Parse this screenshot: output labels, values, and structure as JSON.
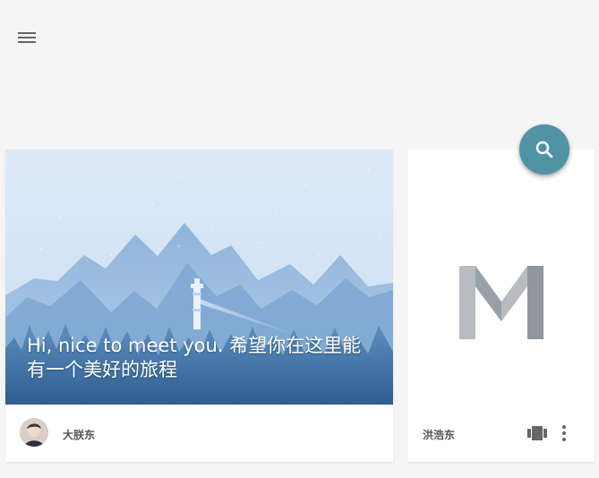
{
  "toolbar": {
    "menu_icon": "hamburger-menu-icon",
    "search_icon": "search-icon"
  },
  "cards": [
    {
      "hero_text": "Hi, nice to meet you. 希望你在这里能有一个美好的旅程",
      "author": "大朕东",
      "hero_icon": "landscape-lighthouse-image"
    },
    {
      "author": "洪浩东",
      "logo": "m-logo-icon",
      "actions": [
        "gallery-icon",
        "more-vert-icon"
      ]
    }
  ],
  "colors": {
    "fab": "#4f93a5",
    "background": "#f5f5f5",
    "card": "#ffffff",
    "text_secondary": "#555555",
    "icon": "#666666"
  }
}
